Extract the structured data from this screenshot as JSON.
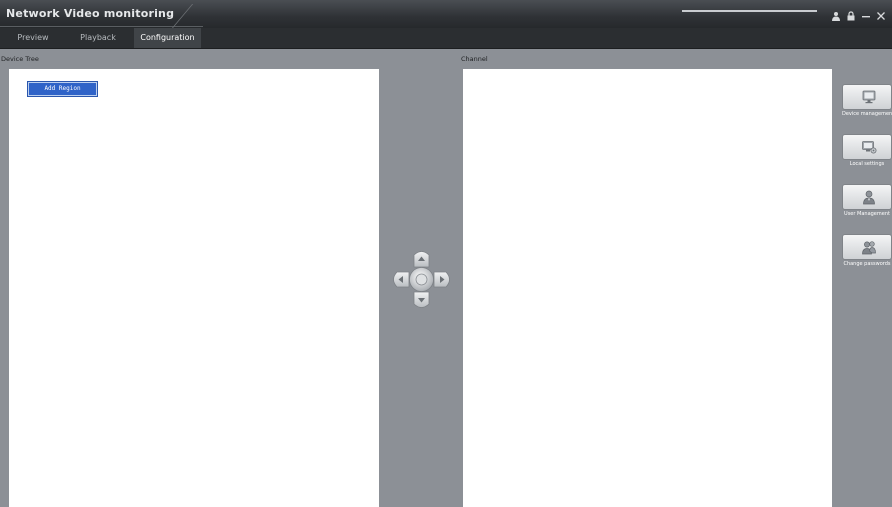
{
  "window": {
    "title": "Network Video monitoring",
    "controls": [
      {
        "name": "user-icon"
      },
      {
        "name": "lock-icon"
      },
      {
        "name": "minimize-icon"
      },
      {
        "name": "close-icon"
      }
    ]
  },
  "menu": {
    "tabs": [
      {
        "label": "Preview",
        "active": false
      },
      {
        "label": "Playback",
        "active": false
      },
      {
        "label": "Configuration",
        "active": true
      }
    ]
  },
  "device_tree": {
    "label": "Device Tree",
    "add_region_label": "Add Region"
  },
  "channel": {
    "label": "Channel"
  },
  "transfer_control": {
    "icons": [
      "arrow-up-icon",
      "arrow-left-icon",
      "center-icon",
      "arrow-right-icon",
      "arrow-down-icon"
    ]
  },
  "side_menu": {
    "items": [
      {
        "label": "Device management",
        "icon": "monitor-icon"
      },
      {
        "label": "Local settings",
        "icon": "computer-settings-icon"
      },
      {
        "label": "User Management",
        "icon": "user-icon"
      },
      {
        "label": "Change passwords",
        "icon": "users-password-icon"
      }
    ]
  },
  "colors": {
    "titlebar": "#2f3236",
    "menubar": "#2b2e31",
    "background": "#8c9096",
    "panel": "#ffffff",
    "accent": "#2f63c8"
  }
}
